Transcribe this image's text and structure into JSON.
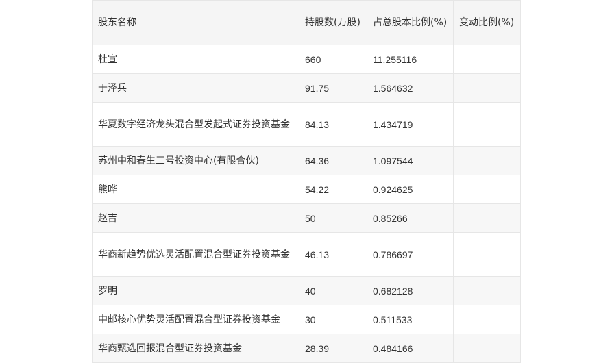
{
  "table": {
    "headers": [
      "股东名称",
      "持股数(万股)",
      "占总股本比例(%)",
      "变动比例(%)"
    ],
    "rows": [
      {
        "name": "杜宣",
        "shares": "660",
        "ratio": "11.255116",
        "change": ""
      },
      {
        "name": "于泽兵",
        "shares": "91.75",
        "ratio": "1.564632",
        "change": ""
      },
      {
        "name": "华夏数字经济龙头混合型发起式证券投资基金",
        "shares": "84.13",
        "ratio": "1.434719",
        "change": ""
      },
      {
        "name": "苏州中和春生三号投资中心(有限合伙)",
        "shares": "64.36",
        "ratio": "1.097544",
        "change": ""
      },
      {
        "name": "熊晔",
        "shares": "54.22",
        "ratio": "0.924625",
        "change": ""
      },
      {
        "name": "赵吉",
        "shares": "50",
        "ratio": "0.85266",
        "change": ""
      },
      {
        "name": "华商新趋势优选灵活配置混合型证券投资基金",
        "shares": "46.13",
        "ratio": "0.786697",
        "change": ""
      },
      {
        "name": "罗明",
        "shares": "40",
        "ratio": "0.682128",
        "change": ""
      },
      {
        "name": "中邮核心优势灵活配置混合型证券投资基金",
        "shares": "30",
        "ratio": "0.511533",
        "change": ""
      },
      {
        "name": "华商甄选回报混合型证券投资基金",
        "shares": "28.39",
        "ratio": "0.484166",
        "change": ""
      }
    ]
  }
}
